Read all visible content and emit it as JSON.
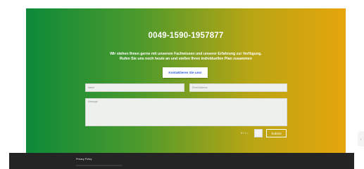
{
  "contact": {
    "phone": "0049-1590-1957877",
    "description_line1": "Wir stehen Ihnen gerne mit unserem Fachwissen und unserer Erfahrung zur Verfügung.",
    "description_line2": "Rufen Sie uns noch heute an und stellen Ihren individuellen Plan zusammen",
    "cta_label": "Kontaktieren Sie uns!"
  },
  "form": {
    "name_placeholder": "Name",
    "email_placeholder": "Email Address",
    "message_placeholder": "Message",
    "captcha_label": "9 + 1 =",
    "submit_label": "Submit"
  },
  "footer": {
    "privacy_label": "Privacy Policy"
  },
  "colors": {
    "gradient_start": "#0d8a3a",
    "gradient_end": "#e6a50c",
    "cta_text": "#2a5bd7",
    "footer_bg": "#242424"
  }
}
